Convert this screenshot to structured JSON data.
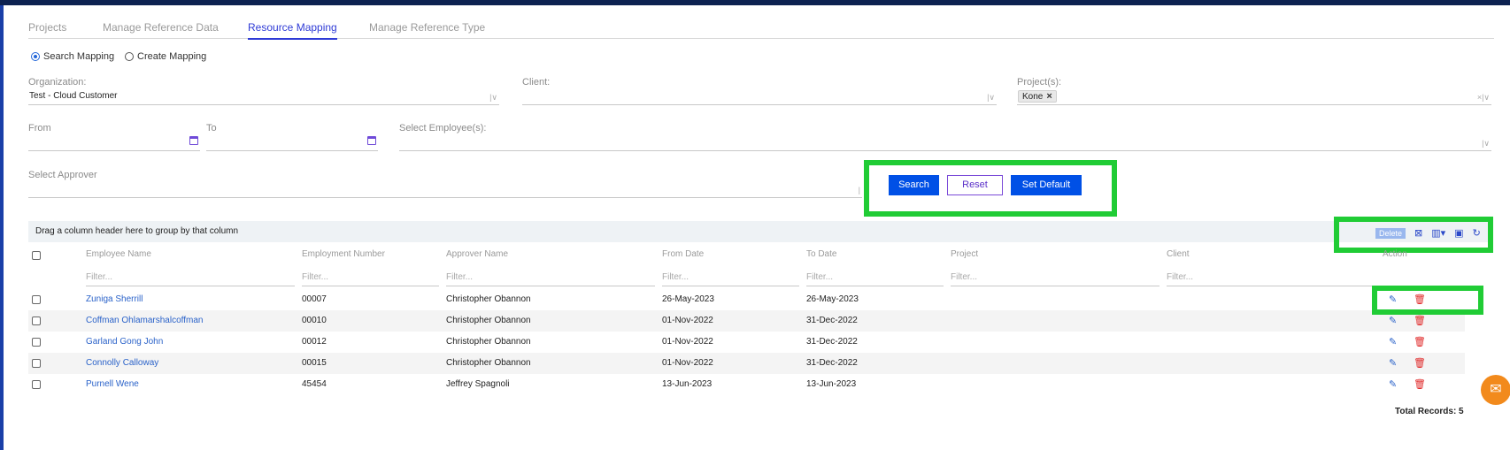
{
  "tabs": [
    "Projects",
    "Manage Reference Data",
    "Resource Mapping",
    "Manage Reference Type"
  ],
  "mode": {
    "search": "Search Mapping",
    "create": "Create Mapping"
  },
  "filters": {
    "organization_label": "Organization:",
    "organization_value": "Test - Cloud Customer",
    "client_label": "Client:",
    "projects_label": "Project(s):",
    "project_chip": "Kone",
    "from_label": "From",
    "to_label": "To",
    "employees_label": "Select Employee(s):",
    "approver_label": "Select Approver"
  },
  "buttons": {
    "search": "Search",
    "reset": "Reset",
    "set_default": "Set Default"
  },
  "grid": {
    "group_hint": "Drag a column header here to group by that column",
    "delete_label": "Delete",
    "columns": [
      "Employee Name",
      "Employment Number",
      "Approver Name",
      "From Date",
      "To Date",
      "Project",
      "Client",
      "Action"
    ],
    "filter_placeholder": "Filter...",
    "rows": [
      {
        "name": "Zuniga Sherrill",
        "number": "00007",
        "approver": "Christopher Obannon",
        "from": "26-May-2023",
        "to": "26-May-2023"
      },
      {
        "name": "Coffman Ohlamarshalcoffman",
        "number": "00010",
        "approver": "Christopher Obannon",
        "from": "01-Nov-2022",
        "to": "31-Dec-2022"
      },
      {
        "name": "Garland Gong John",
        "number": "00012",
        "approver": "Christopher Obannon",
        "from": "01-Nov-2022",
        "to": "31-Dec-2022"
      },
      {
        "name": "Connolly Calloway",
        "number": "00015",
        "approver": "Christopher Obannon",
        "from": "01-Nov-2022",
        "to": "31-Dec-2022"
      },
      {
        "name": "Purnell Wene",
        "number": "45454",
        "approver": "Jeffrey Spagnoli",
        "from": "13-Jun-2023",
        "to": "13-Jun-2023"
      }
    ],
    "total": "Total Records: 5"
  }
}
